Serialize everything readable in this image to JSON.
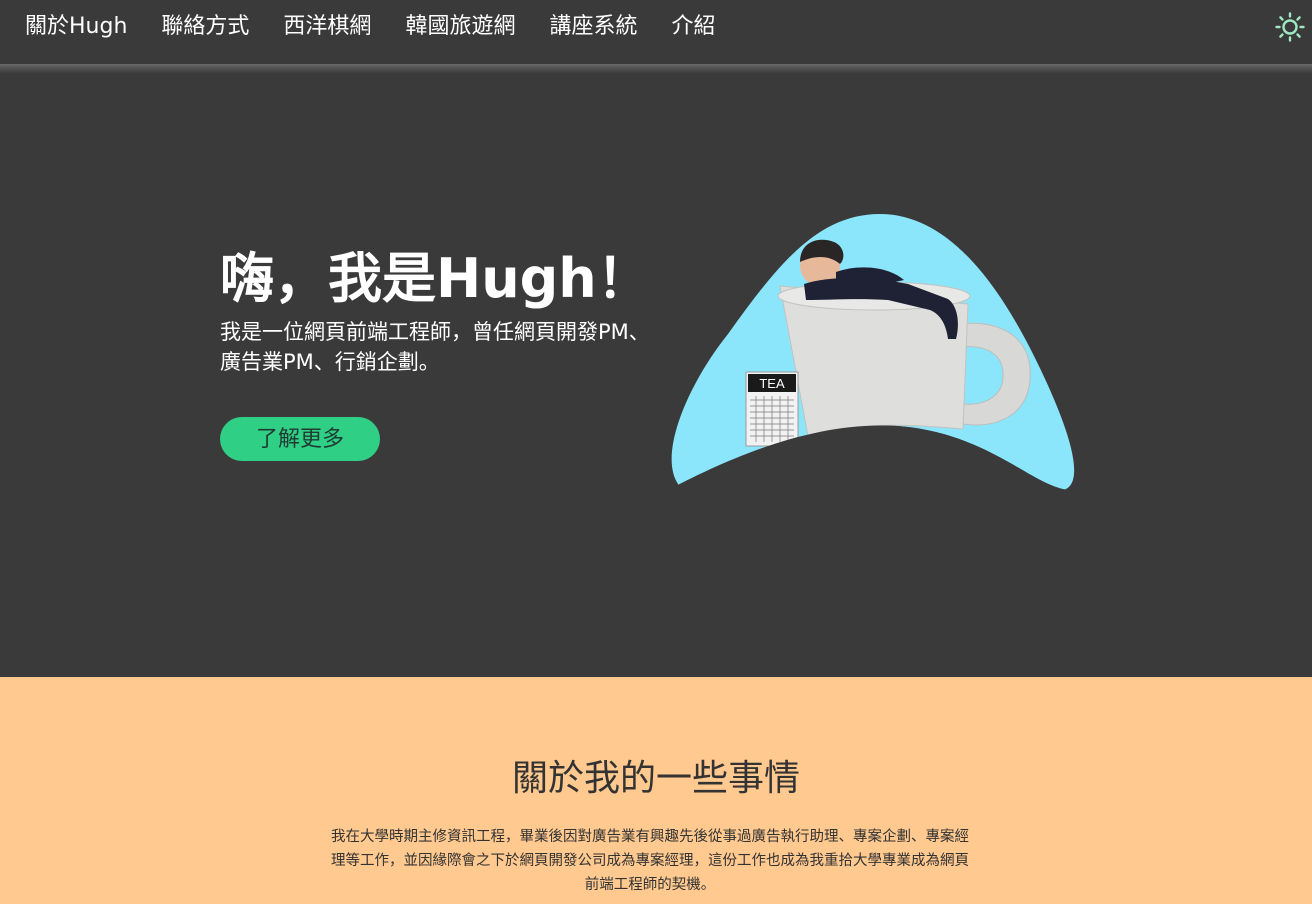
{
  "nav": {
    "items": [
      {
        "label": "關於Hugh"
      },
      {
        "label": "聯絡方式"
      },
      {
        "label": "西洋棋網"
      },
      {
        "label": "韓國旅遊網"
      },
      {
        "label": "講座系統"
      },
      {
        "label": "介紹"
      }
    ],
    "theme_icon": "sun-icon"
  },
  "hero": {
    "title": "嗨，我是Hugh！",
    "subtitle": "我是一位網頁前端工程師，曾任網頁開發PM、廣告業PM、行銷企劃。",
    "cta_label": "了解更多",
    "image_tag_text": "TEA"
  },
  "about": {
    "title": "關於我的一些事情",
    "text": "我在大學時期主修資訊工程，畢業後因對廣告業有興趣先後從事過廣告執行助理、專案企劃、專案經理等工作，並因緣際會之下於網頁開發公司成為專案經理，這份工作也成為我重拾大學專業成為網頁前端工程師的契機。"
  },
  "colors": {
    "background": "#3a3a3a",
    "accent_green": "#2fcf86",
    "about_background": "#ffc98f",
    "blob_blue": "#8be6fb",
    "sun_icon": "#9fe8c2"
  }
}
